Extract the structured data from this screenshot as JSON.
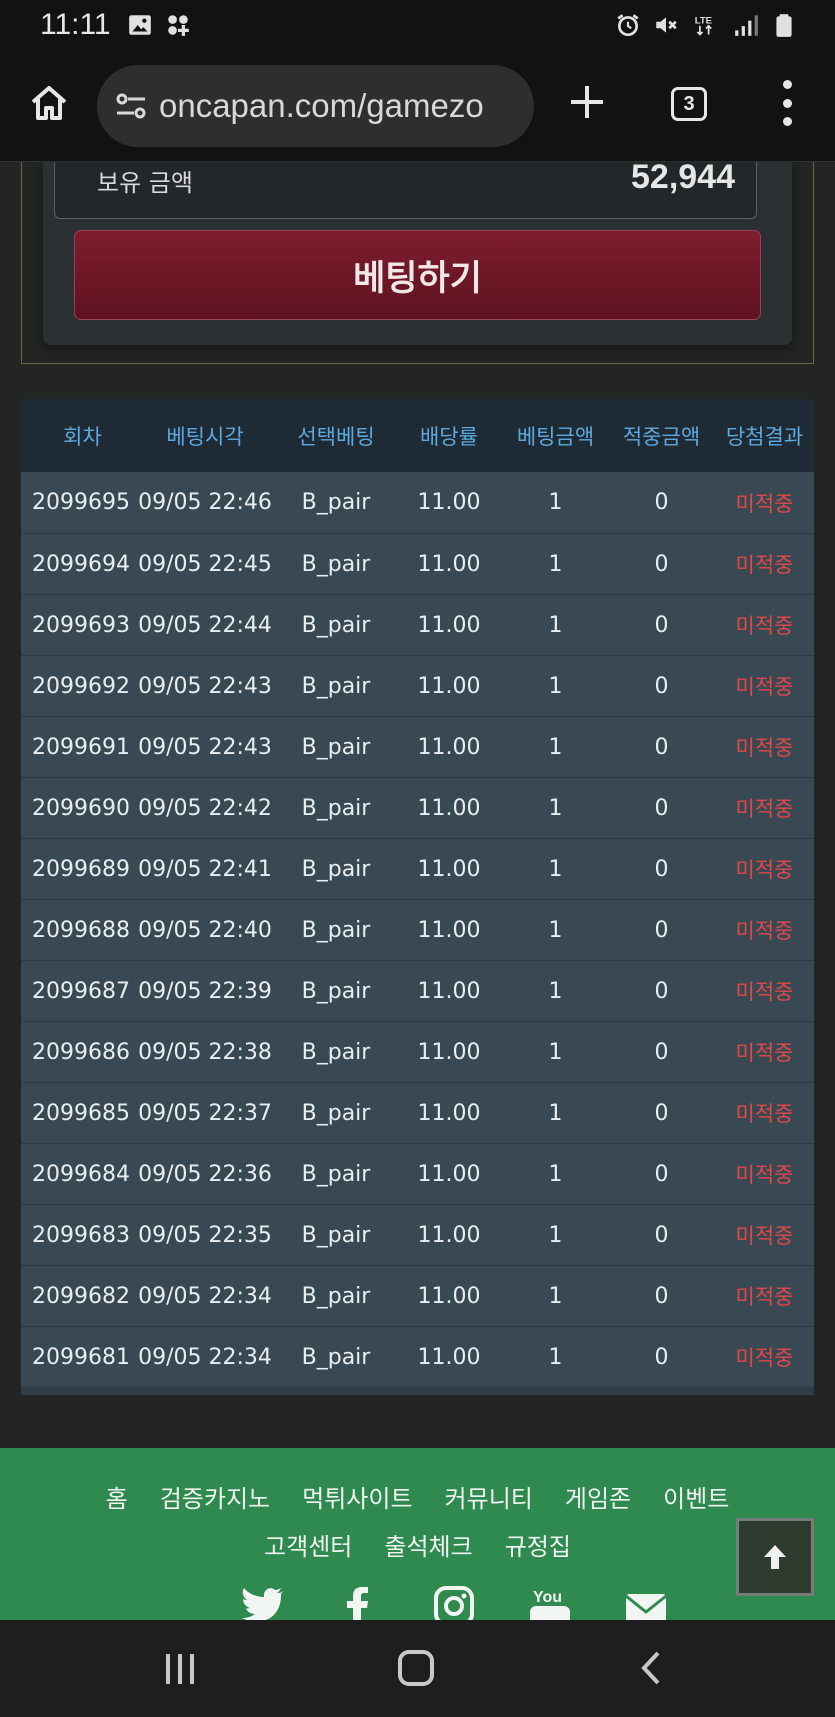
{
  "status_bar": {
    "time": "11:11",
    "network": "LTE"
  },
  "browser": {
    "url": "oncapan.com/gamezo",
    "tab_count": "3"
  },
  "bet_panel": {
    "balance_label": "보유 금액",
    "balance_value": "52,944",
    "bet_button_label": "베팅하기"
  },
  "table": {
    "headers": [
      "회차",
      "베팅시각",
      "선택베팅",
      "배당률",
      "베팅금액",
      "적중금액",
      "당첨결과"
    ],
    "rows": [
      [
        "2099695",
        "09/05 22:46",
        "B_pair",
        "11.00",
        "1",
        "0",
        "미적중"
      ],
      [
        "2099694",
        "09/05 22:45",
        "B_pair",
        "11.00",
        "1",
        "0",
        "미적중"
      ],
      [
        "2099693",
        "09/05 22:44",
        "B_pair",
        "11.00",
        "1",
        "0",
        "미적중"
      ],
      [
        "2099692",
        "09/05 22:43",
        "B_pair",
        "11.00",
        "1",
        "0",
        "미적중"
      ],
      [
        "2099691",
        "09/05 22:43",
        "B_pair",
        "11.00",
        "1",
        "0",
        "미적중"
      ],
      [
        "2099690",
        "09/05 22:42",
        "B_pair",
        "11.00",
        "1",
        "0",
        "미적중"
      ],
      [
        "2099689",
        "09/05 22:41",
        "B_pair",
        "11.00",
        "1",
        "0",
        "미적중"
      ],
      [
        "2099688",
        "09/05 22:40",
        "B_pair",
        "11.00",
        "1",
        "0",
        "미적중"
      ],
      [
        "2099687",
        "09/05 22:39",
        "B_pair",
        "11.00",
        "1",
        "0",
        "미적중"
      ],
      [
        "2099686",
        "09/05 22:38",
        "B_pair",
        "11.00",
        "1",
        "0",
        "미적중"
      ],
      [
        "2099685",
        "09/05 22:37",
        "B_pair",
        "11.00",
        "1",
        "0",
        "미적중"
      ],
      [
        "2099684",
        "09/05 22:36",
        "B_pair",
        "11.00",
        "1",
        "0",
        "미적중"
      ],
      [
        "2099683",
        "09/05 22:35",
        "B_pair",
        "11.00",
        "1",
        "0",
        "미적중"
      ],
      [
        "2099682",
        "09/05 22:34",
        "B_pair",
        "11.00",
        "1",
        "0",
        "미적중"
      ],
      [
        "2099681",
        "09/05 22:34",
        "B_pair",
        "11.00",
        "1",
        "0",
        "미적중"
      ]
    ]
  },
  "footer": {
    "links_line1": [
      "홈",
      "검증카지노",
      "먹튀사이트",
      "커뮤니티",
      "게임존",
      "이벤트"
    ],
    "links_line2": [
      "고객센터",
      "출석체크",
      "규정집"
    ],
    "social_icons": [
      "twitter-icon",
      "facebook-icon",
      "instagram-icon",
      "youtube-icon",
      "email-icon"
    ]
  },
  "colors": {
    "accent_header_text": "#5da9df",
    "result_miss": "#e44747",
    "bet_button": "#7e1d2e",
    "footer_bg": "#2f8a4f"
  }
}
